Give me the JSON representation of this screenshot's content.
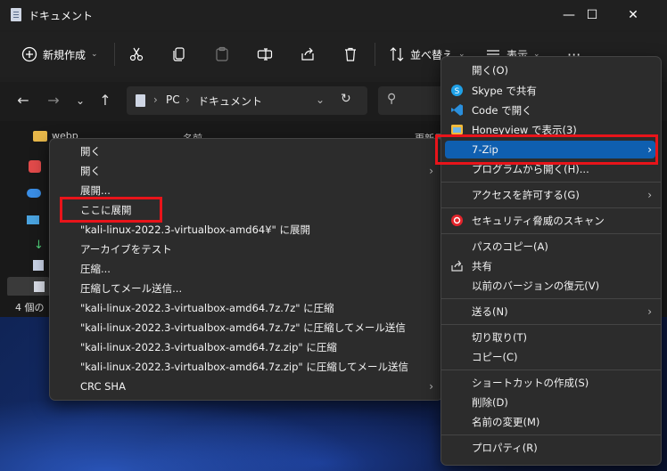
{
  "window": {
    "title": "ドキュメント"
  },
  "toolbar": {
    "new_label": "新規作成",
    "sort_label": "並べ替え",
    "view_label": "表示"
  },
  "address": {
    "pc": "PC",
    "folder": "ドキュメント"
  },
  "content": {
    "sidebar_first": "webp",
    "name_header": "名前",
    "date_header": "更新日",
    "status": "4 個の"
  },
  "left_menu": {
    "items": [
      "開く",
      "開く",
      "展開...",
      "ここに展開",
      "\"kali-linux-2022.3-virtualbox-amd64¥\" に展開",
      "アーカイブをテスト",
      "圧縮...",
      "圧縮してメール送信...",
      "\"kali-linux-2022.3-virtualbox-amd64.7z.7z\" に圧縮",
      "\"kali-linux-2022.3-virtualbox-amd64.7z.7z\" に圧縮してメール送信",
      "\"kali-linux-2022.3-virtualbox-amd64.7z.zip\" に圧縮",
      "\"kali-linux-2022.3-virtualbox-amd64.7z.zip\" に圧縮してメール送信",
      "CRC SHA"
    ]
  },
  "right_menu": {
    "open": "開く(O)",
    "skype": "Skype で共有",
    "code": "Code で開く",
    "honeyview": "Honeyview で表示(3)",
    "zip": "7-Zip",
    "open_with": "プログラムから開く(H)...",
    "access": "アクセスを許可する(G)",
    "security": "セキュリティ脅威のスキャン",
    "copy_path": "パスのコピー(A)",
    "share": "共有",
    "restore": "以前のバージョンの復元(V)",
    "send": "送る(N)",
    "cut": "切り取り(T)",
    "copy": "コピー(C)",
    "shortcut": "ショートカットの作成(S)",
    "delete": "削除(D)",
    "rename": "名前の変更(M)",
    "properties": "プロパティ(R)"
  },
  "colors": {
    "highlight": "#0f5fb0",
    "annotation": "#e8141a"
  }
}
